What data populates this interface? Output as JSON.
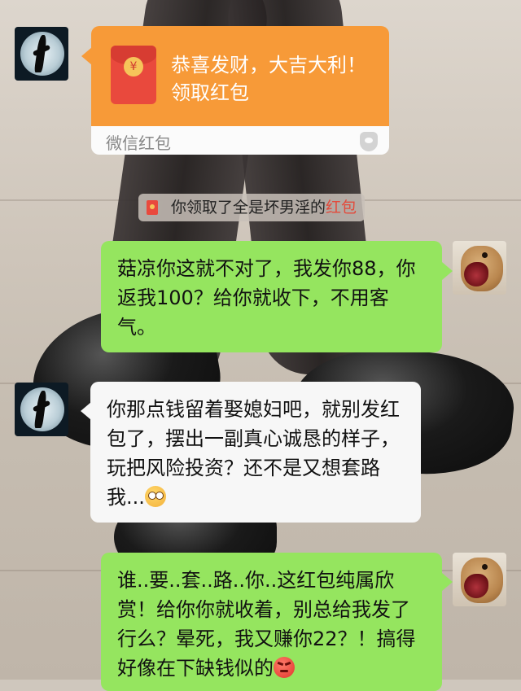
{
  "red_packet": {
    "greeting": "恭喜发财，大吉大利！",
    "action": "领取红包",
    "footer": "微信红包",
    "coin_symbol": "¥"
  },
  "notice": {
    "prefix": "你领取了全是坏男淫的",
    "highlight": "红包"
  },
  "messages": [
    {
      "side": "right",
      "text": "菇凉你这就不对了，我发你88，你返我100？给你就收下，不用客气。"
    },
    {
      "side": "left",
      "text": "你那点钱留着娶媳妇吧，就别发红包了，摆出一副真心诚恳的样子，玩把风险投资？还不是又想套路我...",
      "emoji": "flushed-face-emoji"
    },
    {
      "side": "right",
      "text": "谁..要..套..路..你..这红包纯属欣赏！给你你就收着，别总给我发了行么？晕死，我又赚你22？！搞得好像在下缺钱似的",
      "emoji": "angry-face-emoji"
    }
  ],
  "colors": {
    "green_bubble": "#95e55f",
    "white_bubble": "#f7f7f7",
    "red_packet_orange": "#f79a38",
    "highlight_red": "#e34a3b"
  }
}
